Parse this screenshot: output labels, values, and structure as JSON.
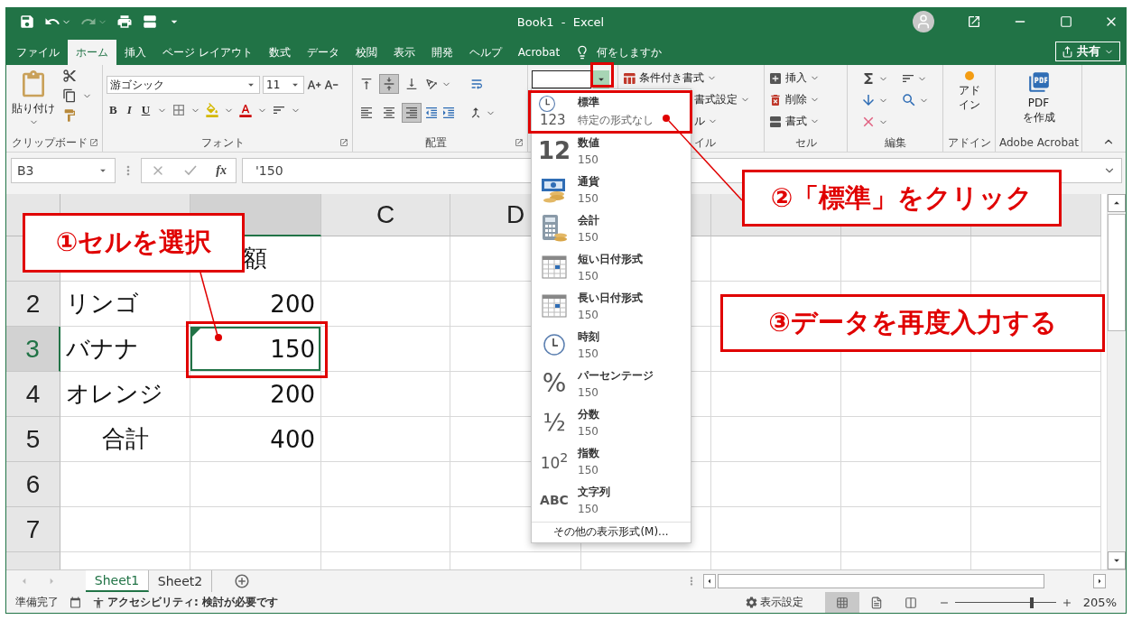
{
  "window": {
    "title": "Book1  -  Excel"
  },
  "tabs": [
    {
      "label": "ファイル",
      "selected": false
    },
    {
      "label": "ホーム",
      "selected": true
    },
    {
      "label": "挿入",
      "selected": false
    },
    {
      "label": "ページ レイアウト",
      "selected": false
    },
    {
      "label": "数式",
      "selected": false
    },
    {
      "label": "データ",
      "selected": false
    },
    {
      "label": "校閲",
      "selected": false
    },
    {
      "label": "表示",
      "selected": false
    },
    {
      "label": "開発",
      "selected": false
    },
    {
      "label": "ヘルプ",
      "selected": false
    },
    {
      "label": "Acrobat",
      "selected": false
    }
  ],
  "tell_me": "何をしますか",
  "share_button": "共有",
  "ribbon": {
    "clipboard": {
      "paste": "貼り付け",
      "label": "クリップボード"
    },
    "font": {
      "name": "游ゴシック",
      "size": "11",
      "bold": "B",
      "italic": "I",
      "underline": "U",
      "label": "フォント"
    },
    "alignment": {
      "label": "配置",
      "vertical": [
        {
          "kind": "top",
          "selected": false
        },
        {
          "kind": "middle",
          "selected": true
        },
        {
          "kind": "bottom",
          "selected": false
        }
      ],
      "horizontal": [
        {
          "kind": "left",
          "selected": false
        },
        {
          "kind": "center",
          "selected": false
        },
        {
          "kind": "right",
          "selected": true
        }
      ]
    },
    "styles": {
      "items": [
        "条件付き書式",
        "書式設定",
        "ル"
      ],
      "label": "イル"
    },
    "cells": {
      "items": [
        "挿入",
        "削除",
        "書式"
      ],
      "label": "セル"
    },
    "editing": {
      "label": "編集"
    },
    "addins": {
      "button": "アドイン",
      "label": "アドイン"
    },
    "acrobat": {
      "button": "PDF\nを作成",
      "label": "Adobe Acrobat"
    }
  },
  "formula_bar": {
    "name_box": "B3",
    "function_label": "fx",
    "value": "'150"
  },
  "sheet": {
    "columns": [
      {
        "selected": false
      },
      {
        "selected": true
      },
      {
        "label": "C",
        "selected": false
      },
      {
        "label": "D",
        "selected": false
      }
    ],
    "rows": [
      {
        "kind": "heading",
        "b": "額",
        "selected": false
      },
      {
        "kind": "item",
        "header": "2",
        "a": "リンゴ",
        "b": "200",
        "selected": false
      },
      {
        "kind": "item",
        "header": "3",
        "a": "バナナ",
        "b": "150",
        "selected": true,
        "b_flag": true
      },
      {
        "kind": "item",
        "header": "4",
        "a": "オレンジ",
        "b": "200",
        "selected": false
      },
      {
        "kind": "total",
        "header": "5",
        "a": "合計",
        "b": "400",
        "selected": false
      },
      {
        "kind": "item",
        "header": "6",
        "selected": false
      },
      {
        "kind": "item",
        "header": "7",
        "selected": false
      }
    ]
  },
  "number_format_menu": {
    "items": [
      {
        "kind": "general",
        "icon_text": "123",
        "name": "標準",
        "sample": "特定の形式なし"
      },
      {
        "kind": "number",
        "icon_text": "12",
        "name": "数値",
        "sample": "150"
      },
      {
        "kind": "currency",
        "name": "通貨",
        "sample": "150"
      },
      {
        "kind": "accounting",
        "name": "会計",
        "sample": "150"
      },
      {
        "kind": "date",
        "name": "短い日付形式",
        "sample": "150"
      },
      {
        "kind": "date",
        "name": "長い日付形式",
        "sample": "150"
      },
      {
        "kind": "time",
        "name": "時刻",
        "sample": "150"
      },
      {
        "kind": "percent",
        "icon_text": "%",
        "name": "パーセンテージ",
        "sample": "150"
      },
      {
        "kind": "fraction",
        "icon_text": "½",
        "name": "分数",
        "sample": "150"
      },
      {
        "kind": "scientific",
        "icon_text": "10$^{2}$",
        "name": "指数",
        "sample": "150"
      },
      {
        "kind": "text",
        "icon_text": "ABC",
        "name": "文字列",
        "sample": "150"
      }
    ],
    "footer": "その他の表示形式(M)..."
  },
  "callouts": [
    {
      "text": "①セルを選択"
    },
    {
      "text": "②「標準」をクリック"
    },
    {
      "text": "③データを再度入力する"
    }
  ],
  "sheet_tabs": [
    {
      "label": "Sheet1",
      "selected": true
    },
    {
      "label": "Sheet2",
      "selected": false
    }
  ],
  "status_bar": {
    "ready": "準備完了",
    "accessibility": "アクセシビリティ: 検討が必要です",
    "display_settings": "表示設定",
    "views": [
      {
        "kind": "normal",
        "selected": true
      },
      {
        "kind": "layout",
        "selected": false
      },
      {
        "kind": "break",
        "selected": false
      }
    ],
    "zoom": {
      "level": 0.76,
      "reading": "205%"
    }
  }
}
